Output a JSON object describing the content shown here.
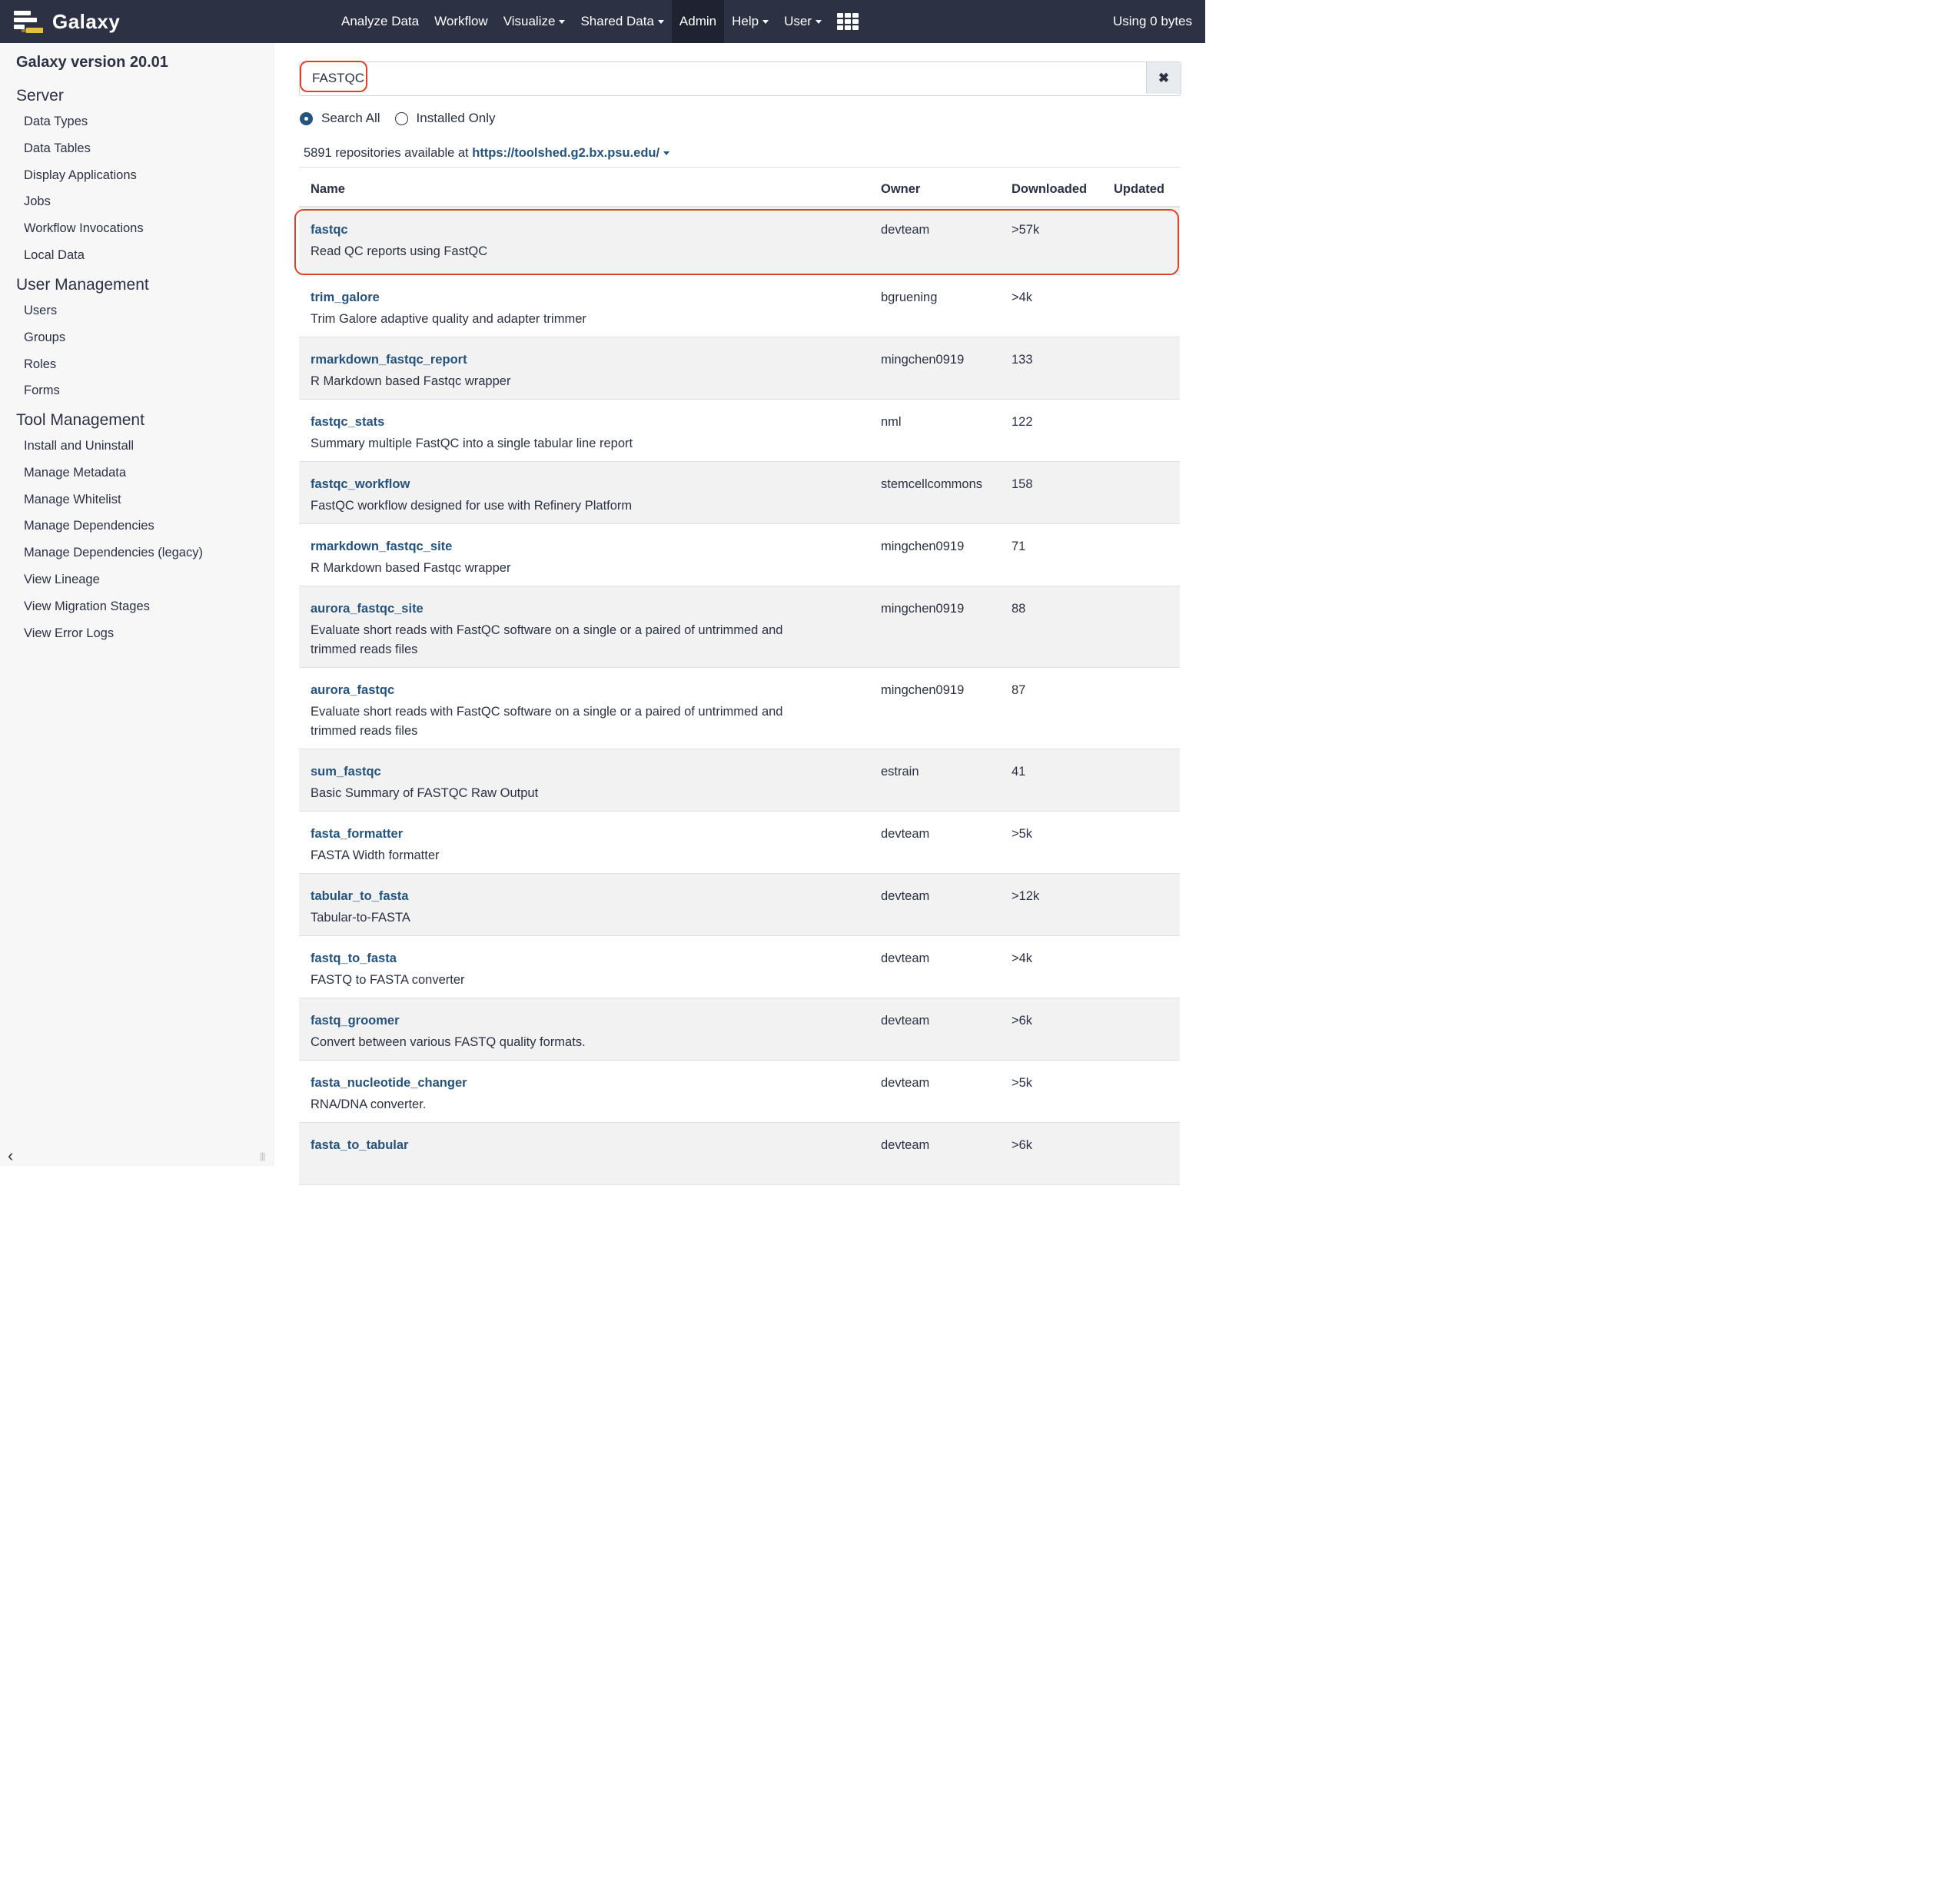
{
  "navbar": {
    "brand": "Galaxy",
    "items": [
      {
        "label": "Analyze Data",
        "dropdown": false
      },
      {
        "label": "Workflow",
        "dropdown": false
      },
      {
        "label": "Visualize",
        "dropdown": true
      },
      {
        "label": "Shared Data",
        "dropdown": true
      },
      {
        "label": "Admin",
        "dropdown": false,
        "active": true
      },
      {
        "label": "Help",
        "dropdown": true
      },
      {
        "label": "User",
        "dropdown": true
      }
    ],
    "usage": "Using 0 bytes"
  },
  "sidebar": {
    "version": "Galaxy version 20.01",
    "sections": [
      {
        "title": "Server",
        "items": [
          "Data Types",
          "Data Tables",
          "Display Applications",
          "Jobs",
          "Workflow Invocations",
          "Local Data"
        ]
      },
      {
        "title": "User Management",
        "items": [
          "Users",
          "Groups",
          "Roles",
          "Forms"
        ]
      },
      {
        "title": "Tool Management",
        "items": [
          "Install and Uninstall",
          "Manage Metadata",
          "Manage Whitelist",
          "Manage Dependencies",
          "Manage Dependencies (legacy)",
          "View Lineage",
          "View Migration Stages",
          "View Error Logs"
        ]
      }
    ]
  },
  "search": {
    "value": "FASTQC",
    "clear_icon": "times-icon"
  },
  "filters": {
    "search_all": "Search All",
    "installed_only": "Installed Only",
    "selected": "search_all"
  },
  "repo_info": {
    "prefix": "5891 repositories available at",
    "url": "https://toolshed.g2.bx.psu.edu/"
  },
  "table": {
    "headers": {
      "name": "Name",
      "owner": "Owner",
      "downloaded": "Downloaded",
      "updated": "Updated"
    },
    "rows": [
      {
        "name": "fastqc",
        "desc": "Read QC reports using FastQC",
        "owner": "devteam",
        "downloaded": ">57k"
      },
      {
        "name": "trim_galore",
        "desc": "Trim Galore adaptive quality and adapter trimmer",
        "owner": "bgruening",
        "downloaded": ">4k"
      },
      {
        "name": "rmarkdown_fastqc_report",
        "desc": "R Markdown based Fastqc wrapper",
        "owner": "mingchen0919",
        "downloaded": "133"
      },
      {
        "name": "fastqc_stats",
        "desc": "Summary multiple FastQC into a single tabular line report",
        "owner": "nml",
        "downloaded": "122"
      },
      {
        "name": "fastqc_workflow",
        "desc": "FastQC workflow designed for use with Refinery Platform",
        "owner": "stemcellcommons",
        "downloaded": "158"
      },
      {
        "name": "rmarkdown_fastqc_site",
        "desc": "R Markdown based Fastqc wrapper",
        "owner": "mingchen0919",
        "downloaded": "71"
      },
      {
        "name": "aurora_fastqc_site",
        "desc": "Evaluate short reads with FastQC software on a single or a paired of untrimmed and trimmed reads files",
        "owner": "mingchen0919",
        "downloaded": "88"
      },
      {
        "name": "aurora_fastqc",
        "desc": "Evaluate short reads with FastQC software on a single or a paired of untrimmed and trimmed reads files",
        "owner": "mingchen0919",
        "downloaded": "87"
      },
      {
        "name": "sum_fastqc",
        "desc": "Basic Summary of FASTQC Raw Output",
        "owner": "estrain",
        "downloaded": "41"
      },
      {
        "name": "fasta_formatter",
        "desc": "FASTA Width formatter",
        "owner": "devteam",
        "downloaded": ">5k"
      },
      {
        "name": "tabular_to_fasta",
        "desc": "Tabular-to-FASTA",
        "owner": "devteam",
        "downloaded": ">12k"
      },
      {
        "name": "fastq_to_fasta",
        "desc": "FASTQ to FASTA converter",
        "owner": "devteam",
        "downloaded": ">4k"
      },
      {
        "name": "fastq_groomer",
        "desc": "Convert between various FASTQ quality formats.",
        "owner": "devteam",
        "downloaded": ">6k"
      },
      {
        "name": "fasta_nucleotide_changer",
        "desc": "RNA/DNA converter.",
        "owner": "devteam",
        "downloaded": ">5k"
      },
      {
        "name": "fasta_to_tabular",
        "desc": "",
        "owner": "devteam",
        "downloaded": ">6k"
      }
    ]
  },
  "colors": {
    "navbar": "#2c3143",
    "link": "#25537b",
    "highlight": "#e0402a"
  }
}
